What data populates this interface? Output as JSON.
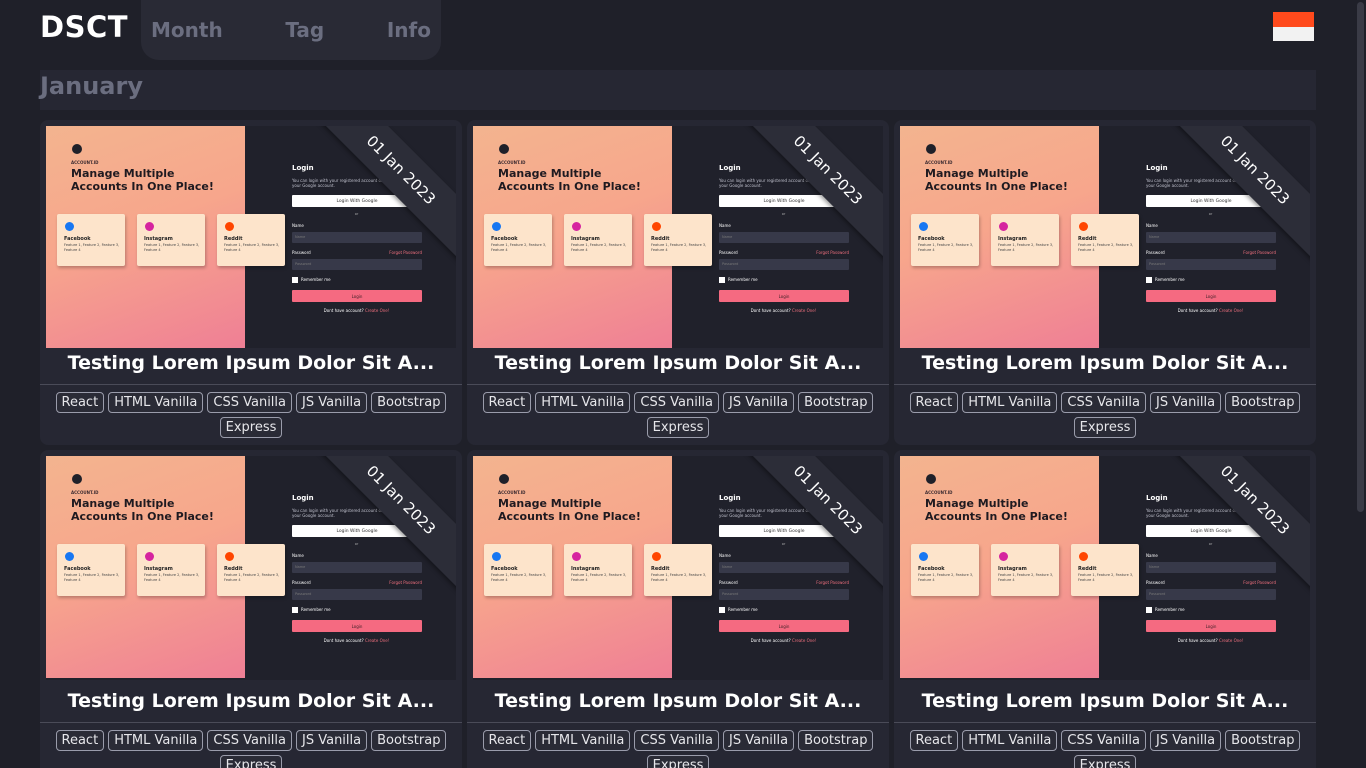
{
  "header": {
    "brand": "DSCT",
    "nav": [
      "Month",
      "Tag",
      "Info"
    ],
    "flag": {
      "colors": [
        "#ff4a1c",
        "#f2f2f2"
      ],
      "icon": "indonesia-flag-icon"
    }
  },
  "section": {
    "month": "January"
  },
  "cards": [
    {
      "date": "01 Jan 2023",
      "title": "Testing Lorem Ipsum Dolor Sit A...",
      "tags": [
        "React",
        "HTML Vanilla",
        "CSS Vanilla",
        "JS Vanilla",
        "Bootstrap",
        "Express"
      ]
    },
    {
      "date": "01 Jan 2023",
      "title": "Testing Lorem Ipsum Dolor Sit A...",
      "tags": [
        "React",
        "HTML Vanilla",
        "CSS Vanilla",
        "JS Vanilla",
        "Bootstrap",
        "Express"
      ]
    },
    {
      "date": "01 Jan 2023",
      "title": "Testing Lorem Ipsum Dolor Sit A...",
      "tags": [
        "React",
        "HTML Vanilla",
        "CSS Vanilla",
        "JS Vanilla",
        "Bootstrap",
        "Express"
      ]
    },
    {
      "date": "01 Jan 2023",
      "title": "Testing Lorem Ipsum Dolor Sit A...",
      "tags": [
        "React",
        "HTML Vanilla",
        "CSS Vanilla",
        "JS Vanilla",
        "Bootstrap",
        "Express"
      ]
    },
    {
      "date": "01 Jan 2023",
      "title": "Testing Lorem Ipsum Dolor Sit A...",
      "tags": [
        "React",
        "HTML Vanilla",
        "CSS Vanilla",
        "JS Vanilla",
        "Bootstrap",
        "Express"
      ]
    },
    {
      "date": "01 Jan 2023",
      "title": "Testing Lorem Ipsum Dolor Sit A...",
      "tags": [
        "React",
        "HTML Vanilla",
        "CSS Vanilla",
        "JS Vanilla",
        "Bootstrap",
        "Express"
      ]
    }
  ],
  "preview": {
    "brand_label": "ACCOUNT.ID",
    "headline": "Manage Multiple Accounts In One Place!",
    "tiles": [
      {
        "name": "Facebook",
        "desc": "Feature 1, Feature 2, Feature 3, Feature 4",
        "color": "#1877f2",
        "icon": "facebook-icon"
      },
      {
        "name": "Instagram",
        "desc": "Feature 1, Feature 2, Feature 3, Feature 4",
        "color": "#d6249f",
        "icon": "instagram-icon"
      },
      {
        "name": "Reddit",
        "desc": "Feature 1, Feature 2, Feature 3, Feature 4",
        "color": "#ff4500",
        "icon": "reddit-icon"
      }
    ],
    "login_title": "Login",
    "login_sub": "You can login with your registered account or quick login with your Google account.",
    "google_btn": "Login With Google",
    "or": "or",
    "name_label": "Name",
    "name_placeholder": "Name",
    "password_label": "Password",
    "password_placeholder": "Password",
    "forgot": "Forgot Password",
    "remember": "Remember me",
    "login_btn": "Login",
    "no_account": "Dont have account?",
    "create": "Create One!"
  }
}
